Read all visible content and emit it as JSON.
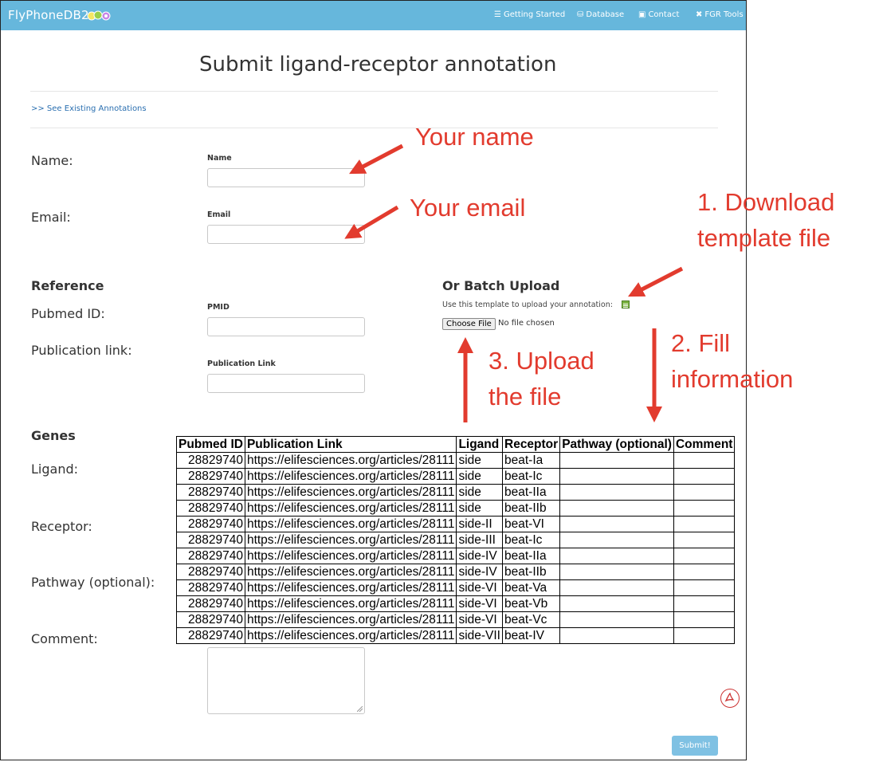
{
  "navbar": {
    "brand": "FlyPhoneDB2",
    "items": [
      {
        "icon": "list-icon",
        "label": "Getting Started"
      },
      {
        "icon": "database-icon",
        "label": "Database"
      },
      {
        "icon": "contact-card-icon",
        "label": "Contact"
      },
      {
        "icon": "tools-icon",
        "label": "FGR Tools"
      }
    ]
  },
  "page": {
    "title": "Submit ligand-receptor annotation",
    "existing_link": ">> See Existing Annotations"
  },
  "form": {
    "name_label": "Name:",
    "name_field_label": "Name",
    "email_label": "Email:",
    "email_field_label": "Email",
    "reference_heading": "Reference",
    "pubmed_label": "Pubmed ID:",
    "pmid_field_label": "PMID",
    "publication_label": "Publication link:",
    "publication_field_label": "Publication Link",
    "genes_heading": "Genes",
    "ligand_label": "Ligand:",
    "receptor_label": "Receptor:",
    "pathway_label": "Pathway (optional):",
    "comment_label": "Comment:",
    "submit_label": "Submit!"
  },
  "batch": {
    "heading": "Or Batch Upload",
    "hint": "Use this template to upload your annotation:",
    "template_icon": "spreadsheet-icon",
    "choose_file_label": "Choose File",
    "no_file_text": "No file chosen"
  },
  "annotations": {
    "your_name": "Your name",
    "your_email": "Your email",
    "step1_line1": "1. Download",
    "step1_line2": "template file",
    "step2_line1": "2. Fill",
    "step2_line2": "information",
    "step3_line1": "3. Upload",
    "step3_line2": "the file",
    "color": "#e23b2e"
  },
  "template_table": {
    "headers": [
      "Pubmed ID",
      "Publication Link",
      "Ligand",
      "Receptor",
      "Pathway (optional)",
      "Comment"
    ],
    "rows": [
      [
        "28829740",
        "https://elifesciences.org/articles/28111",
        "side",
        "beat-Ia",
        "",
        ""
      ],
      [
        "28829740",
        "https://elifesciences.org/articles/28111",
        "side",
        "beat-Ic",
        "",
        ""
      ],
      [
        "28829740",
        "https://elifesciences.org/articles/28111",
        "side",
        "beat-IIa",
        "",
        ""
      ],
      [
        "28829740",
        "https://elifesciences.org/articles/28111",
        "side",
        "beat-IIb",
        "",
        ""
      ],
      [
        "28829740",
        "https://elifesciences.org/articles/28111",
        "side-II",
        "beat-VI",
        "",
        ""
      ],
      [
        "28829740",
        "https://elifesciences.org/articles/28111",
        "side-III",
        "beat-Ic",
        "",
        ""
      ],
      [
        "28829740",
        "https://elifesciences.org/articles/28111",
        "side-IV",
        "beat-IIa",
        "",
        ""
      ],
      [
        "28829740",
        "https://elifesciences.org/articles/28111",
        "side-IV",
        "beat-IIb",
        "",
        ""
      ],
      [
        "28829740",
        "https://elifesciences.org/articles/28111",
        "side-VI",
        "beat-Va",
        "",
        ""
      ],
      [
        "28829740",
        "https://elifesciences.org/articles/28111",
        "side-VI",
        "beat-Vb",
        "",
        ""
      ],
      [
        "28829740",
        "https://elifesciences.org/articles/28111",
        "side-VI",
        "beat-Vc",
        "",
        ""
      ],
      [
        "28829740",
        "https://elifesciences.org/articles/28111",
        "side-VII",
        "beat-IV",
        "",
        ""
      ]
    ]
  }
}
